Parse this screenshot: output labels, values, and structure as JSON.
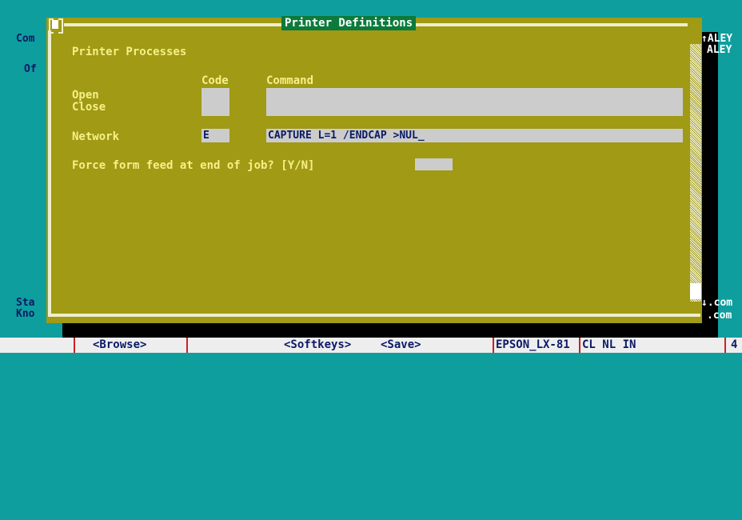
{
  "background_left": {
    "line1": "Com",
    "line2": "Of",
    "line3": "Sta",
    "line4": "Kno"
  },
  "background_right": {
    "line1": "ALEY",
    "line2": "ALEY",
    "line3": ".com",
    "line4": ".com"
  },
  "dialog": {
    "title": "Printer Definitions",
    "section_heading": "Printer Processes",
    "col_code": "Code",
    "col_command": "Command",
    "open_label": "Open",
    "close_label": "Close",
    "network_label": "Network",
    "network_code": "E",
    "network_command": "CAPTURE L=1 /ENDCAP >NUL",
    "cursor": "_",
    "force_ff_label": "Force form feed at end of job? [Y/N]",
    "force_ff_value": ""
  },
  "scroll": {
    "up_arrow": "↑",
    "down_arrow": "↓"
  },
  "statusbar": {
    "browse": "<Browse>",
    "softkeys": "<Softkeys>",
    "save": "<Save>",
    "printer": "EPSON_LX-81",
    "modes": "CL NL IN",
    "edge": "4"
  },
  "colors": {
    "desktop": "#0f9e9e",
    "dialog": "#a09a14",
    "title_bg": "#0b7a3a",
    "label": "#f5f08a",
    "field": "#cccccc"
  }
}
